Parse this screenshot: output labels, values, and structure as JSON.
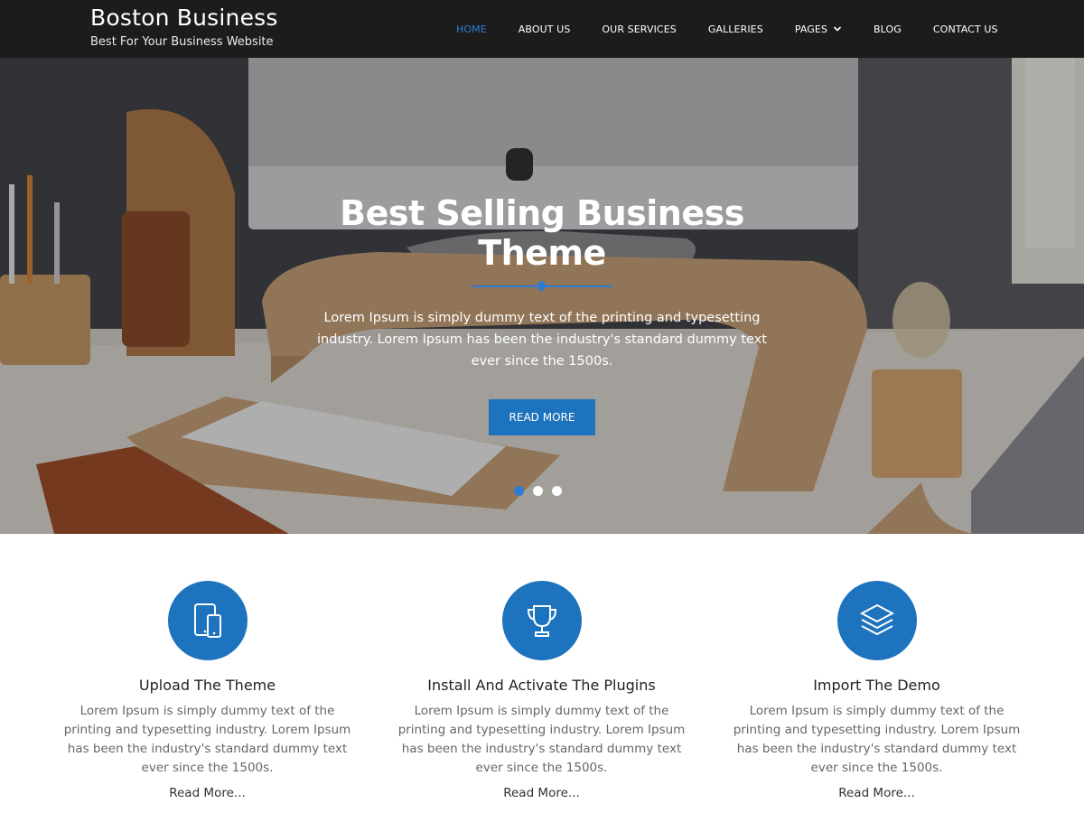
{
  "site": {
    "title": "Boston Business",
    "tagline": "Best For Your Business Website"
  },
  "nav": {
    "items": [
      {
        "label": "HOME",
        "active": true
      },
      {
        "label": "ABOUT US"
      },
      {
        "label": "OUR SERVICES"
      },
      {
        "label": "GALLERIES"
      },
      {
        "label": "PAGES",
        "has_dropdown": true
      },
      {
        "label": "BLOG"
      },
      {
        "label": "CONTACT US"
      }
    ]
  },
  "hero": {
    "title": "Best Selling Business Theme",
    "text": "Lorem Ipsum is simply dummy text of the printing and typesetting industry. Lorem Ipsum has been the industry's standard dummy text ever since the 1500s.",
    "button": "READ MORE",
    "slides": 3,
    "active_slide": 1
  },
  "features": [
    {
      "icon": "devices-icon",
      "title": "Upload The Theme",
      "text": "Lorem Ipsum is simply dummy text of the printing and typesetting industry. Lorem Ipsum has been the industry's standard dummy text ever since the 1500s.",
      "link": "Read More..."
    },
    {
      "icon": "trophy-icon",
      "title": "Install And Activate The Plugins",
      "text": "Lorem Ipsum is simply dummy text of the printing and typesetting industry. Lorem Ipsum has been the industry's standard dummy text ever since the 1500s.",
      "link": "Read More..."
    },
    {
      "icon": "layers-icon",
      "title": "Import The Demo",
      "text": "Lorem Ipsum is simply dummy text of the printing and typesetting industry. Lorem Ipsum has been the industry's standard dummy text ever since the 1500s.",
      "link": "Read More..."
    }
  ],
  "colors": {
    "accent": "#1e73be",
    "header_bg": "#1c1c1c"
  }
}
